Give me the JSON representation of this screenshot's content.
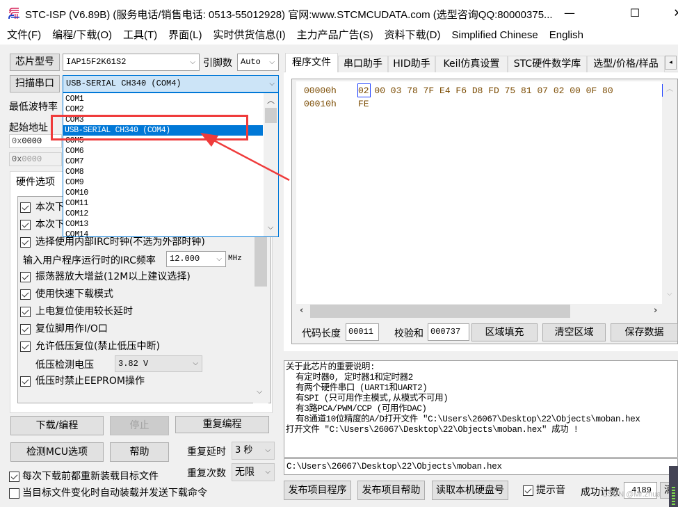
{
  "window": {
    "title": "STC-ISP (V6.89B) (服务电话/销售电话: 0513-55012928) 官网:www.STCMCUDATA.com  (选型咨询QQ:80000375...",
    "controls": {
      "minimize": "—",
      "maximize": "☐",
      "close": "✕"
    }
  },
  "menu": [
    "文件(F)",
    "编程/下载(O)",
    "工具(T)",
    "界面(L)",
    "实时供货信息(I)",
    "主力产品广告(S)",
    "资料下载(D)",
    "Simplified Chinese",
    "English"
  ],
  "left": {
    "chip_type_button": "芯片型号",
    "chip_type_value": "IAP15F2K61S2",
    "pins_label": "引脚数",
    "pins_value": "Auto",
    "scan_port_button": "扫描串口",
    "port_value": "USB-SERIAL CH340 (COM4)",
    "min_baud_label": "最低波特率",
    "start_addr_label": "起始地址",
    "start_addr_1_prefix": "0x",
    "start_addr_1": "0000",
    "start_addr_2_prefix": "0x",
    "start_addr_2": "0000",
    "hw_tab": "硬件选项",
    "hw_options": [
      {
        "label": "本次下",
        "checked": true
      },
      {
        "label": "本次下",
        "checked": true
      },
      {
        "label": "选择使用内部IRC时钟(不选为外部时钟)",
        "checked": true
      }
    ],
    "irc_label": "输入用户程序运行时的IRC频率",
    "irc_value": "12.000",
    "irc_unit": "MHz",
    "hw_options_2": [
      {
        "label": "振荡器放大增益(12M以上建议选择)",
        "checked": true
      },
      {
        "label": "使用快速下载模式",
        "checked": true
      },
      {
        "label": "上电复位使用较长延时",
        "checked": true
      },
      {
        "label": "复位脚用作I/O口",
        "checked": true
      },
      {
        "label": "允许低压复位(禁止低压中断)",
        "checked": true
      }
    ],
    "lvd_label": "低压检测电压",
    "lvd_value": "3.82 V",
    "eeprom_option": {
      "label": "低压时禁止EEPROM操作",
      "checked": true
    },
    "download_button": "下载/编程",
    "stop_button": "停止",
    "repeat_program_button": "重复编程",
    "check_mcu_button": "检测MCU选项",
    "help_button": "帮助",
    "repeat_delay_label": "重复延时",
    "repeat_delay_value": "3 秒",
    "repeat_count_label": "重复次数",
    "repeat_count_value": "无限",
    "reload_option": {
      "label": "每次下载前都重新装载目标文件",
      "checked": true
    },
    "auto_option": {
      "label": "当目标文件变化时自动装载并发送下载命令",
      "checked": false
    }
  },
  "port_dropdown": {
    "items": [
      "COM1",
      "COM2",
      "COM3",
      "USB-SERIAL CH340 (COM4)",
      "COM5",
      "COM6",
      "COM7",
      "COM8",
      "COM9",
      "COM10",
      "COM11",
      "COM12",
      "COM13",
      "COM14"
    ],
    "selected_index": 3
  },
  "right": {
    "tabs": [
      "程序文件",
      "串口助手",
      "HID助手",
      "Keil仿真设置",
      "STC硬件数学库",
      "选型/价格/样品"
    ],
    "active_tab": 0,
    "hex": [
      {
        "addr": "00000h",
        "bytes": "02 00 03 78 7F E4 F6 D8 FD 75 81 07 02 00 0F 80"
      },
      {
        "addr": "00010h",
        "bytes": "FE"
      }
    ],
    "code_len_label": "代码长度",
    "code_len_value": "00011",
    "checksum_label": "校验和",
    "checksum_value": "000737",
    "fill_button": "区域填充",
    "clear_button": "清空区域",
    "save_button": "保存数据",
    "info_lines": [
      "关于此芯片的重要说明:",
      "  有定时器0, 定时器1和定时器2",
      "  有两个硬件串口 (UART1和UART2)",
      "  有SPI (只可用作主模式,从模式不可用)",
      "  有3路PCA/PWM/CCP (可用作DAC)",
      "  有8通道10位精度的A/D打开文件 \"C:\\Users\\26067\\Desktop\\22\\Objects\\moban.hex",
      "打开文件 \"C:\\Users\\26067\\Desktop\\22\\Objects\\moban.hex\" 成功 !"
    ],
    "file_path": "C:\\Users\\26067\\Desktop\\22\\Objects\\moban.hex",
    "publish_program_button": "发布项目程序",
    "publish_help_button": "发布项目帮助",
    "read_disk_button": "读取本机硬盘号",
    "sound_option": {
      "label": "提示音",
      "checked": true
    },
    "success_count_label": "成功计数",
    "success_count_value": "4189",
    "clear_count_button": "清"
  },
  "watermark": "CSDN @Mr.zhua",
  "colors": {
    "selection": "#0078d7",
    "annotation": "#ef3b3b",
    "hex_text": "#7a4a00"
  }
}
